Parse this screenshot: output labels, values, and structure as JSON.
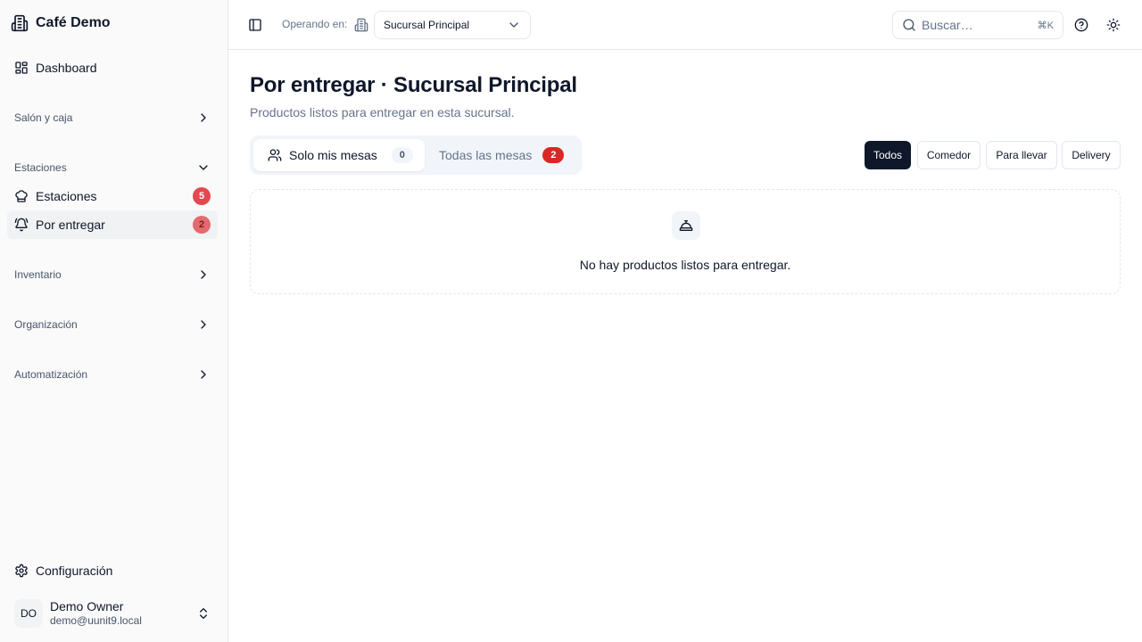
{
  "sidebar": {
    "brand": "Café Demo",
    "dashboard": "Dashboard",
    "groups": {
      "salon": "Salón y caja",
      "estaciones": "Estaciones",
      "inventario": "Inventario",
      "organizacion": "Organización",
      "automatizacion": "Automatización"
    },
    "items": {
      "estaciones": {
        "label": "Estaciones",
        "badge": "5"
      },
      "por_entregar": {
        "label": "Por entregar",
        "badge": "2"
      }
    },
    "configuracion": "Configuración",
    "user": {
      "initials": "DO",
      "name": "Demo Owner",
      "email": "demo@uunit9.local"
    }
  },
  "header": {
    "operando_label": "Operando en:",
    "branch": "Sucursal Principal",
    "search_placeholder": "Buscar…",
    "search_shortcut": "⌘K"
  },
  "main": {
    "title": "Por entregar · Sucursal Principal",
    "subtitle": "Productos listos para entregar en esta sucursal.",
    "tabs": [
      {
        "label": "Solo mis mesas",
        "count": "0"
      },
      {
        "label": "Todas las mesas",
        "count": "2"
      }
    ],
    "filters": [
      "Todos",
      "Comedor",
      "Para llevar",
      "Delivery"
    ],
    "empty_message": "No hay productos listos para entregar."
  },
  "colors": {
    "accent": "#0f172a",
    "badge_red": "#dc2626",
    "muted": "#64748b",
    "border": "#e2e8f0"
  },
  "icons": [
    "building-icon",
    "dashboard-icon",
    "chevron-right-icon",
    "chevron-down-icon",
    "chef-hat-icon",
    "bell-icon",
    "gear-icon",
    "chevrons-up-down-icon",
    "sidebar-toggle-icon",
    "search-icon",
    "help-icon",
    "sun-icon",
    "users-icon",
    "concierge-bell-icon"
  ]
}
